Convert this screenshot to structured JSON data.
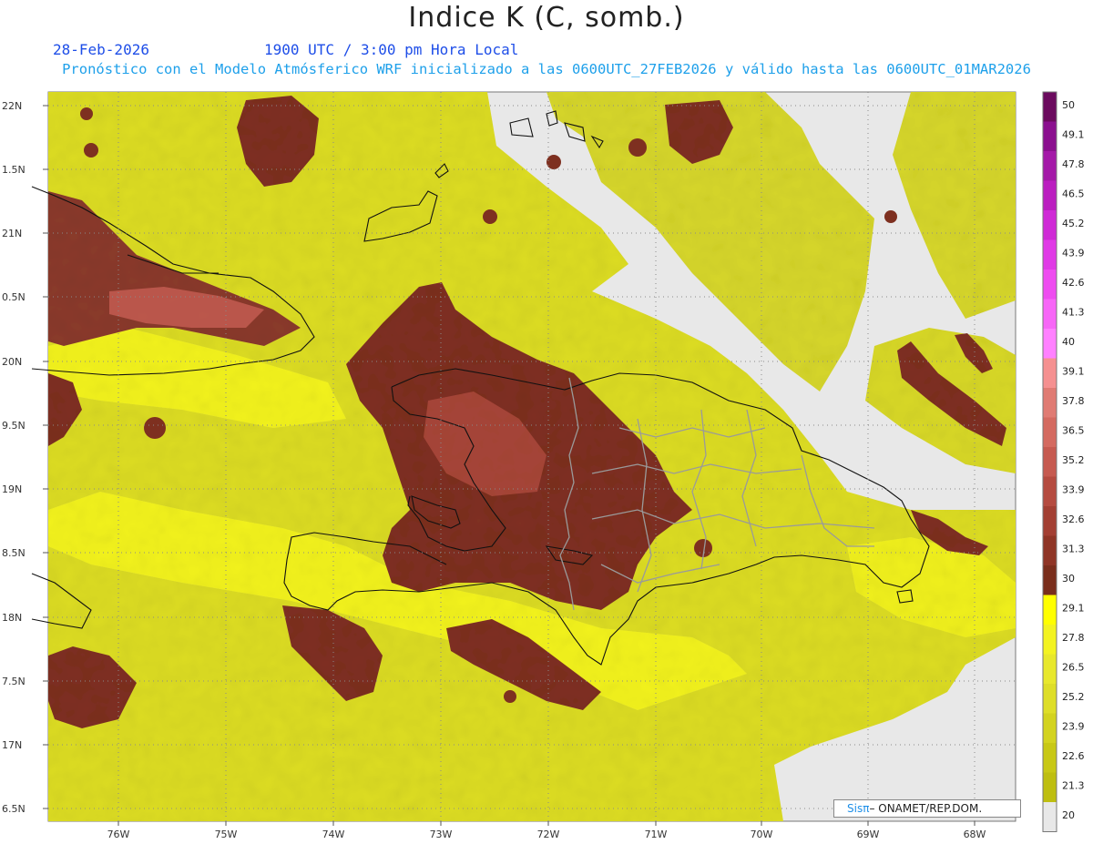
{
  "header": {
    "title": "Indice K (C, somb.)",
    "date": "28-Feb-2026",
    "time": "1900 UTC / 3:00 pm Hora Local",
    "model_line": "Pronóstico con el Modelo Atmósferico WRF inicializado a las 0600UTC_27FEB2026 y válido hasta las  0600UTC_01MAR2026"
  },
  "axes": {
    "lat_labels": [
      "22N",
      "1.5N",
      "21N",
      "0.5N",
      "20N",
      "9.5N",
      "19N",
      "8.5N",
      "18N",
      "7.5N",
      "17N",
      "6.5N"
    ],
    "lon_labels": [
      "76W",
      "75W",
      "74W",
      "73W",
      "72W",
      "71W",
      "70W",
      "69W",
      "68W"
    ]
  },
  "colorbar": {
    "labels": [
      "50",
      "49.1",
      "47.8",
      "46.5",
      "45.2",
      "43.9",
      "42.6",
      "41.3",
      "40",
      "39.1",
      "37.8",
      "36.5",
      "35.2",
      "33.9",
      "32.6",
      "31.3",
      "30",
      "29.1",
      "27.8",
      "26.5",
      "25.2",
      "23.9",
      "22.6",
      "21.3",
      "20"
    ],
    "colors": [
      "#6b0a5e",
      "#8b0f8f",
      "#a419a8",
      "#bb1ec0",
      "#cf2ad6",
      "#e03ae6",
      "#ee4cf0",
      "#f766f7",
      "#ff80ff",
      "#f59090",
      "#e07b73",
      "#d46a60",
      "#c65a50",
      "#b54b40",
      "#a33f33",
      "#8f3526",
      "#7a2e1c",
      "#ffff00",
      "#f3f321",
      "#e8e82c",
      "#dede28",
      "#d3d31f",
      "#c8c815",
      "#bebe10",
      "#e8e8e8"
    ]
  },
  "credit": {
    "prefix": "Sis",
    "pi": "π",
    "suffix": "– ONAMET/REP.DOM."
  }
}
